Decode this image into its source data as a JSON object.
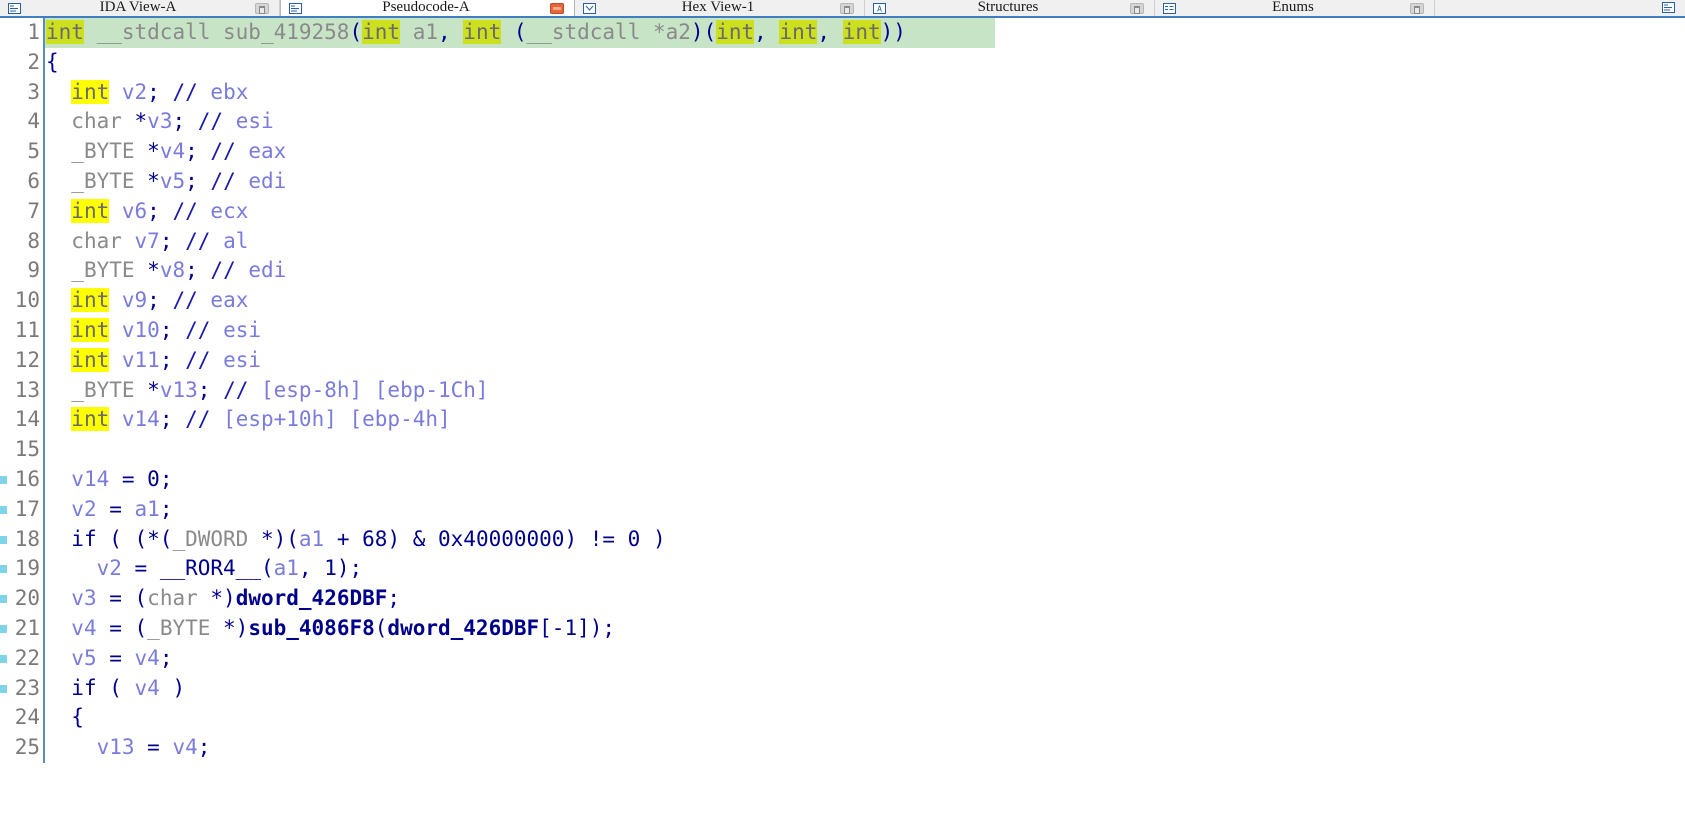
{
  "window": {
    "app": "IDA Pro",
    "accent_color": "#3f7fbf",
    "current_line_color": "#c7e4c7",
    "highlight_color": "#ffff00",
    "highlight_color_on_current": "#cce01f"
  },
  "tabs": [
    {
      "label": "IDA View-A",
      "icon": "view-icon",
      "active": false,
      "button": "minimize-icon"
    },
    {
      "label": "Pseudocode-A",
      "icon": "pseudocode-icon",
      "active": true,
      "button": "close-icon"
    },
    {
      "label": "Hex View-1",
      "icon": "hexview-icon",
      "active": false,
      "button": "minimize-icon"
    },
    {
      "label": "Structures",
      "icon": "structures-icon",
      "active": false,
      "button": "minimize-icon"
    },
    {
      "label": "Enums",
      "icon": "enums-icon",
      "active": false,
      "button": "minimize-icon"
    }
  ],
  "trailing_icon": "next-tab-icon",
  "code": {
    "function_name": "sub_419258",
    "lines": [
      {
        "n": "1",
        "marker": false,
        "current": true,
        "current_bg_width": 950,
        "tokens": [
          {
            "c": "kwg",
            "t": "int"
          },
          {
            "c": "fn",
            "t": " __stdcall sub_419258"
          },
          {
            "c": "ctrl",
            "t": "("
          },
          {
            "c": "kwg",
            "t": "int"
          },
          {
            "c": "fn",
            "t": " a1"
          },
          {
            "c": "ctrl",
            "t": ","
          },
          {
            "c": "fn",
            "t": " "
          },
          {
            "c": "kwg",
            "t": "int"
          },
          {
            "c": "fn",
            "t": " "
          },
          {
            "c": "ctrl",
            "t": "("
          },
          {
            "c": "fn",
            "t": "__stdcall *a2"
          },
          {
            "c": "ctrl",
            "t": ")("
          },
          {
            "c": "kwg",
            "t": "int"
          },
          {
            "c": "ctrl",
            "t": ","
          },
          {
            "c": "fn",
            "t": " "
          },
          {
            "c": "kwg",
            "t": "int"
          },
          {
            "c": "ctrl",
            "t": ","
          },
          {
            "c": "fn",
            "t": " "
          },
          {
            "c": "kwg",
            "t": "int"
          },
          {
            "c": "ctrl",
            "t": "))"
          }
        ]
      },
      {
        "n": "2",
        "marker": false,
        "current": false,
        "tokens": [
          {
            "c": "ctrl",
            "t": "{"
          }
        ]
      },
      {
        "n": "3",
        "marker": false,
        "current": false,
        "tokens": [
          {
            "c": "plain",
            "t": "  "
          },
          {
            "c": "kw",
            "t": "int"
          },
          {
            "c": "var",
            "t": " v2"
          },
          {
            "c": "ctrl",
            "t": ";"
          },
          {
            "c": "plain",
            "t": " "
          },
          {
            "c": "cmtsl",
            "t": "//"
          },
          {
            "c": "cmt",
            "t": " ebx"
          }
        ]
      },
      {
        "n": "4",
        "marker": false,
        "current": false,
        "tokens": [
          {
            "c": "plain",
            "t": "  "
          },
          {
            "c": "type",
            "t": "char "
          },
          {
            "c": "ctrl",
            "t": "*"
          },
          {
            "c": "var",
            "t": "v3"
          },
          {
            "c": "ctrl",
            "t": ";"
          },
          {
            "c": "plain",
            "t": " "
          },
          {
            "c": "cmtsl",
            "t": "//"
          },
          {
            "c": "cmt",
            "t": " esi"
          }
        ]
      },
      {
        "n": "5",
        "marker": false,
        "current": false,
        "tokens": [
          {
            "c": "plain",
            "t": "  "
          },
          {
            "c": "type",
            "t": "_BYTE "
          },
          {
            "c": "ctrl",
            "t": "*"
          },
          {
            "c": "var",
            "t": "v4"
          },
          {
            "c": "ctrl",
            "t": ";"
          },
          {
            "c": "plain",
            "t": " "
          },
          {
            "c": "cmtsl",
            "t": "//"
          },
          {
            "c": "cmt",
            "t": " eax"
          }
        ]
      },
      {
        "n": "6",
        "marker": false,
        "current": false,
        "tokens": [
          {
            "c": "plain",
            "t": "  "
          },
          {
            "c": "type",
            "t": "_BYTE "
          },
          {
            "c": "ctrl",
            "t": "*"
          },
          {
            "c": "var",
            "t": "v5"
          },
          {
            "c": "ctrl",
            "t": ";"
          },
          {
            "c": "plain",
            "t": " "
          },
          {
            "c": "cmtsl",
            "t": "//"
          },
          {
            "c": "cmt",
            "t": " edi"
          }
        ]
      },
      {
        "n": "7",
        "marker": false,
        "current": false,
        "tokens": [
          {
            "c": "plain",
            "t": "  "
          },
          {
            "c": "kw",
            "t": "int"
          },
          {
            "c": "var",
            "t": " v6"
          },
          {
            "c": "ctrl",
            "t": ";"
          },
          {
            "c": "plain",
            "t": " "
          },
          {
            "c": "cmtsl",
            "t": "//"
          },
          {
            "c": "cmt",
            "t": " ecx"
          }
        ]
      },
      {
        "n": "8",
        "marker": false,
        "current": false,
        "tokens": [
          {
            "c": "plain",
            "t": "  "
          },
          {
            "c": "type",
            "t": "char"
          },
          {
            "c": "var",
            "t": " v7"
          },
          {
            "c": "ctrl",
            "t": ";"
          },
          {
            "c": "plain",
            "t": " "
          },
          {
            "c": "cmtsl",
            "t": "//"
          },
          {
            "c": "cmt",
            "t": " al"
          }
        ]
      },
      {
        "n": "9",
        "marker": false,
        "current": false,
        "tokens": [
          {
            "c": "plain",
            "t": "  "
          },
          {
            "c": "type",
            "t": "_BYTE "
          },
          {
            "c": "ctrl",
            "t": "*"
          },
          {
            "c": "var",
            "t": "v8"
          },
          {
            "c": "ctrl",
            "t": ";"
          },
          {
            "c": "plain",
            "t": " "
          },
          {
            "c": "cmtsl",
            "t": "//"
          },
          {
            "c": "cmt",
            "t": " edi"
          }
        ]
      },
      {
        "n": "10",
        "marker": false,
        "current": false,
        "tokens": [
          {
            "c": "plain",
            "t": "  "
          },
          {
            "c": "kw",
            "t": "int"
          },
          {
            "c": "var",
            "t": " v9"
          },
          {
            "c": "ctrl",
            "t": ";"
          },
          {
            "c": "plain",
            "t": " "
          },
          {
            "c": "cmtsl",
            "t": "//"
          },
          {
            "c": "cmt",
            "t": " eax"
          }
        ]
      },
      {
        "n": "11",
        "marker": false,
        "current": false,
        "tokens": [
          {
            "c": "plain",
            "t": "  "
          },
          {
            "c": "kw",
            "t": "int"
          },
          {
            "c": "var",
            "t": " v10"
          },
          {
            "c": "ctrl",
            "t": ";"
          },
          {
            "c": "plain",
            "t": " "
          },
          {
            "c": "cmtsl",
            "t": "//"
          },
          {
            "c": "cmt",
            "t": " esi"
          }
        ]
      },
      {
        "n": "12",
        "marker": false,
        "current": false,
        "tokens": [
          {
            "c": "plain",
            "t": "  "
          },
          {
            "c": "kw",
            "t": "int"
          },
          {
            "c": "var",
            "t": " v11"
          },
          {
            "c": "ctrl",
            "t": ";"
          },
          {
            "c": "plain",
            "t": " "
          },
          {
            "c": "cmtsl",
            "t": "//"
          },
          {
            "c": "cmt",
            "t": " esi"
          }
        ]
      },
      {
        "n": "13",
        "marker": false,
        "current": false,
        "tokens": [
          {
            "c": "plain",
            "t": "  "
          },
          {
            "c": "type",
            "t": "_BYTE "
          },
          {
            "c": "ctrl",
            "t": "*"
          },
          {
            "c": "var",
            "t": "v13"
          },
          {
            "c": "ctrl",
            "t": ";"
          },
          {
            "c": "plain",
            "t": " "
          },
          {
            "c": "cmtsl",
            "t": "//"
          },
          {
            "c": "cmt",
            "t": " [esp-8h] [ebp-1Ch]"
          }
        ]
      },
      {
        "n": "14",
        "marker": false,
        "current": false,
        "tokens": [
          {
            "c": "plain",
            "t": "  "
          },
          {
            "c": "kw",
            "t": "int"
          },
          {
            "c": "var",
            "t": " v14"
          },
          {
            "c": "ctrl",
            "t": ";"
          },
          {
            "c": "plain",
            "t": " "
          },
          {
            "c": "cmtsl",
            "t": "//"
          },
          {
            "c": "cmt",
            "t": " [esp+10h] [ebp-4h]"
          }
        ]
      },
      {
        "n": "15",
        "marker": false,
        "current": false,
        "tokens": []
      },
      {
        "n": "16",
        "marker": true,
        "current": false,
        "tokens": [
          {
            "c": "plain",
            "t": "  "
          },
          {
            "c": "var",
            "t": "v14"
          },
          {
            "c": "op",
            "t": " = "
          },
          {
            "c": "num",
            "t": "0"
          },
          {
            "c": "ctrl",
            "t": ";"
          }
        ]
      },
      {
        "n": "17",
        "marker": true,
        "current": false,
        "tokens": [
          {
            "c": "plain",
            "t": "  "
          },
          {
            "c": "var",
            "t": "v2"
          },
          {
            "c": "op",
            "t": " = "
          },
          {
            "c": "var",
            "t": "a1"
          },
          {
            "c": "ctrl",
            "t": ";"
          }
        ]
      },
      {
        "n": "18",
        "marker": true,
        "current": false,
        "tokens": [
          {
            "c": "plain",
            "t": "  "
          },
          {
            "c": "ctrl",
            "t": "if ( (*("
          },
          {
            "c": "type",
            "t": "_DWORD "
          },
          {
            "c": "ctrl",
            "t": "*)("
          },
          {
            "c": "var",
            "t": "a1"
          },
          {
            "c": "op",
            "t": " + "
          },
          {
            "c": "num",
            "t": "68"
          },
          {
            "c": "ctrl",
            "t": ") & "
          },
          {
            "c": "num",
            "t": "0x40000000"
          },
          {
            "c": "ctrl",
            "t": ") != "
          },
          {
            "c": "num",
            "t": "0"
          },
          {
            "c": "ctrl",
            "t": " )"
          }
        ]
      },
      {
        "n": "19",
        "marker": true,
        "current": false,
        "tokens": [
          {
            "c": "plain",
            "t": "    "
          },
          {
            "c": "var",
            "t": "v2"
          },
          {
            "c": "op",
            "t": " = "
          },
          {
            "c": "ctrl",
            "t": "__ROR4__("
          },
          {
            "c": "var",
            "t": "a1"
          },
          {
            "c": "ctrl",
            "t": ", "
          },
          {
            "c": "num",
            "t": "1"
          },
          {
            "c": "ctrl",
            "t": ");"
          }
        ]
      },
      {
        "n": "20",
        "marker": true,
        "current": false,
        "tokens": [
          {
            "c": "plain",
            "t": "  "
          },
          {
            "c": "var",
            "t": "v3"
          },
          {
            "c": "op",
            "t": " = ("
          },
          {
            "c": "type",
            "t": "char "
          },
          {
            "c": "ctrl",
            "t": "*)"
          },
          {
            "c": "name",
            "t": "dword_426DBF"
          },
          {
            "c": "ctrl",
            "t": ";"
          }
        ]
      },
      {
        "n": "21",
        "marker": true,
        "current": false,
        "tokens": [
          {
            "c": "plain",
            "t": "  "
          },
          {
            "c": "var",
            "t": "v4"
          },
          {
            "c": "op",
            "t": " = ("
          },
          {
            "c": "type",
            "t": "_BYTE "
          },
          {
            "c": "ctrl",
            "t": "*)"
          },
          {
            "c": "name",
            "t": "sub_4086F8"
          },
          {
            "c": "ctrl",
            "t": "("
          },
          {
            "c": "name",
            "t": "dword_426DBF"
          },
          {
            "c": "ctrl",
            "t": "["
          },
          {
            "c": "num",
            "t": "-1"
          },
          {
            "c": "ctrl",
            "t": "]);"
          }
        ]
      },
      {
        "n": "22",
        "marker": true,
        "current": false,
        "tokens": [
          {
            "c": "plain",
            "t": "  "
          },
          {
            "c": "var",
            "t": "v5"
          },
          {
            "c": "op",
            "t": " = "
          },
          {
            "c": "var",
            "t": "v4"
          },
          {
            "c": "ctrl",
            "t": ";"
          }
        ]
      },
      {
        "n": "23",
        "marker": true,
        "current": false,
        "tokens": [
          {
            "c": "plain",
            "t": "  "
          },
          {
            "c": "ctrl",
            "t": "if ( "
          },
          {
            "c": "var",
            "t": "v4"
          },
          {
            "c": "ctrl",
            "t": " )"
          }
        ]
      },
      {
        "n": "24",
        "marker": false,
        "current": false,
        "tokens": [
          {
            "c": "plain",
            "t": "  "
          },
          {
            "c": "ctrl",
            "t": "{"
          }
        ]
      },
      {
        "n": "25",
        "marker": false,
        "current": false,
        "tokens": [
          {
            "c": "plain",
            "t": "    "
          },
          {
            "c": "var",
            "t": "v13"
          },
          {
            "c": "op",
            "t": " = "
          },
          {
            "c": "var",
            "t": "v4"
          },
          {
            "c": "ctrl",
            "t": ";"
          }
        ]
      }
    ]
  }
}
